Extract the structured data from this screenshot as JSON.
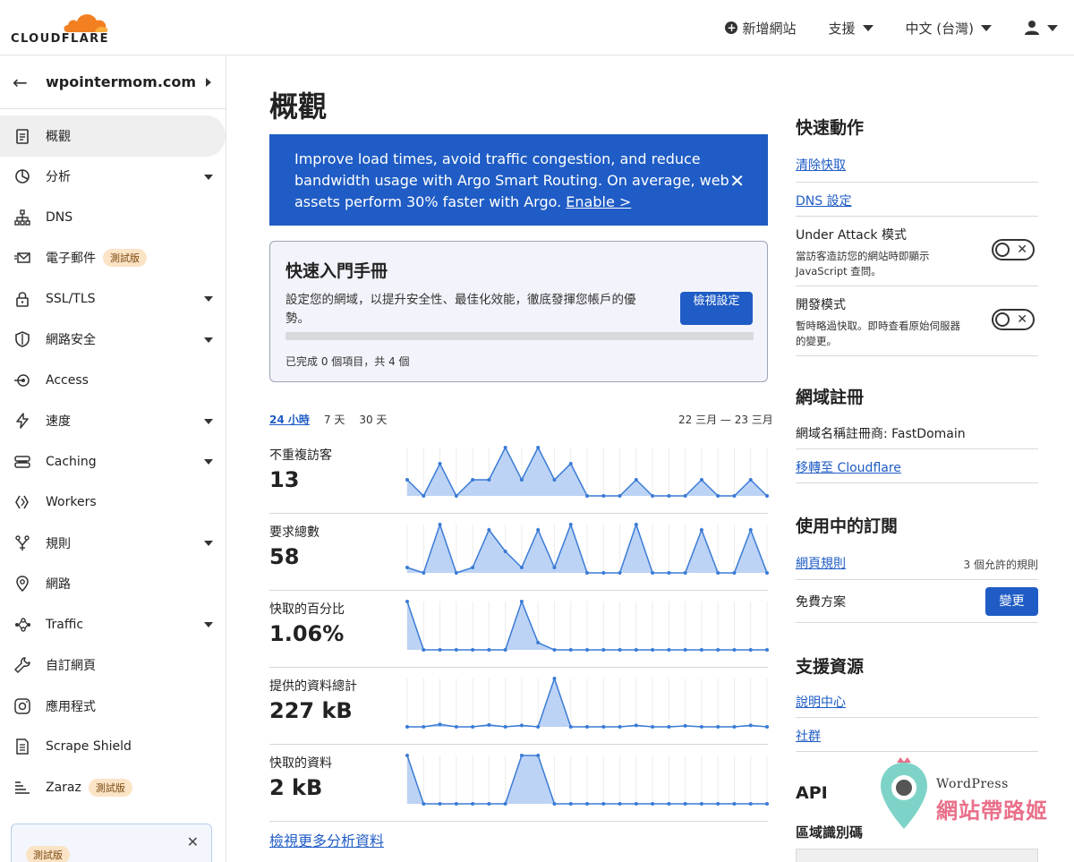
{
  "brand": {
    "logo_text": "CLOUDFLARE",
    "accent": "#f38020"
  },
  "topnav": {
    "add_site": "新增網站",
    "support": "支援",
    "language": "中文 (台灣)"
  },
  "sidebar": {
    "domain": "wpointermom.com",
    "items": [
      {
        "label": "概觀",
        "icon": "clipboard-icon",
        "active": true,
        "caret": false
      },
      {
        "label": "分析",
        "icon": "pie-chart-icon",
        "caret": true
      },
      {
        "label": "DNS",
        "icon": "network-icon",
        "caret": false
      },
      {
        "label": "電子郵件",
        "icon": "email-icon",
        "caret": false,
        "badge": "測試版"
      },
      {
        "label": "SSL/TLS",
        "icon": "lock-icon",
        "caret": true
      },
      {
        "label": "網路安全",
        "icon": "shield-icon",
        "caret": true
      },
      {
        "label": "Access",
        "icon": "access-icon",
        "caret": false
      },
      {
        "label": "速度",
        "icon": "lightning-icon",
        "caret": true
      },
      {
        "label": "Caching",
        "icon": "server-icon",
        "caret": true
      },
      {
        "label": "Workers",
        "icon": "workers-icon",
        "caret": false
      },
      {
        "label": "規則",
        "icon": "filter-icon",
        "caret": true
      },
      {
        "label": "網路",
        "icon": "location-pin-icon",
        "caret": false
      },
      {
        "label": "Traffic",
        "icon": "traffic-icon",
        "caret": true
      },
      {
        "label": "自訂網頁",
        "icon": "wrench-icon",
        "caret": false
      },
      {
        "label": "應用程式",
        "icon": "apps-icon",
        "caret": false
      },
      {
        "label": "Scrape Shield",
        "icon": "document-icon",
        "caret": false
      },
      {
        "label": "Zaraz",
        "icon": "zaraz-icon",
        "caret": false,
        "badge": "測試版"
      }
    ],
    "card_badge": "測試版"
  },
  "main": {
    "title": "概觀",
    "banner": {
      "text": "Improve load times, avoid traffic congestion, and reduce bandwidth usage with Argo Smart Routing. On average, web assets perform 30% faster with Argo. ",
      "link": "Enable >"
    },
    "guide": {
      "title": "快速入門手冊",
      "description": "設定您的網域，以提升安全性、最佳化效能，徹底發揮您帳戶的優勢。",
      "button": "檢視設定",
      "progress": 0,
      "count_text": "已完成 0 個項目，共 4 個"
    },
    "ranges": [
      "24 小時",
      "7 天",
      "30 天"
    ],
    "active_range": 0,
    "date_range": "22 三月 — 23 三月",
    "metrics": [
      {
        "label": "不重複訪客",
        "value": "13",
        "series": [
          1,
          0,
          2,
          0,
          1,
          1,
          3,
          1,
          3,
          1,
          2,
          0,
          0,
          0,
          1,
          0,
          0,
          0,
          1,
          0,
          0,
          1,
          0
        ]
      },
      {
        "label": "要求總數",
        "value": "58",
        "series": [
          1,
          0,
          9,
          0,
          1,
          8,
          4,
          1,
          8,
          1,
          9,
          0,
          0,
          0,
          9,
          0,
          0,
          0,
          8,
          0,
          0,
          8,
          0
        ]
      },
      {
        "label": "快取的百分比",
        "value": "1.06%",
        "series": [
          1,
          0,
          0,
          0,
          0,
          0,
          0,
          1,
          0.15,
          0,
          0,
          0,
          0,
          0,
          0,
          0,
          0,
          0,
          0,
          0,
          0,
          0,
          0
        ]
      },
      {
        "label": "提供的資料總計",
        "value": "227 kB",
        "series": [
          0,
          0,
          0.05,
          0,
          0,
          0.04,
          0,
          0.03,
          0,
          1,
          0,
          0,
          0,
          0,
          0.03,
          0,
          0,
          0.02,
          0,
          0,
          0,
          0.03,
          0
        ]
      },
      {
        "label": "快取的資料",
        "value": "2 kB",
        "series": [
          1,
          0,
          0,
          0,
          0,
          0,
          0,
          1,
          1,
          0,
          0,
          0,
          0,
          0,
          0,
          0,
          0,
          0,
          0,
          0,
          0,
          0,
          0
        ]
      }
    ],
    "more_link": "檢視更多分析資料"
  },
  "right": {
    "quick_title": "快速動作",
    "purge_cache": "清除快取",
    "dns_settings": "DNS 設定",
    "under_attack": {
      "title": "Under Attack 模式",
      "desc": "當訪客造訪您的網站時即顯示 JavaScript 查問。"
    },
    "dev_mode": {
      "title": "開發模式",
      "desc": "暫時略過快取。即時查看原始伺服器的變更。"
    },
    "registration_title": "網域註冊",
    "registrar": "網域名稱註冊商: FastDomain",
    "transfer": "移轉至 Cloudflare",
    "subs_title": "使用中的訂閱",
    "page_rules": "網頁規則",
    "page_rules_note": "3 個允許的規則",
    "plan": "免費方案",
    "change": "變更",
    "support_title": "支援資源",
    "help_center": "說明中心",
    "community": "社群",
    "api_title": "API",
    "zone_id": "區域識別碼"
  },
  "watermark": {
    "line1": "WordPress",
    "line2": "網站帶路姬",
    "color": "#e9708a"
  }
}
